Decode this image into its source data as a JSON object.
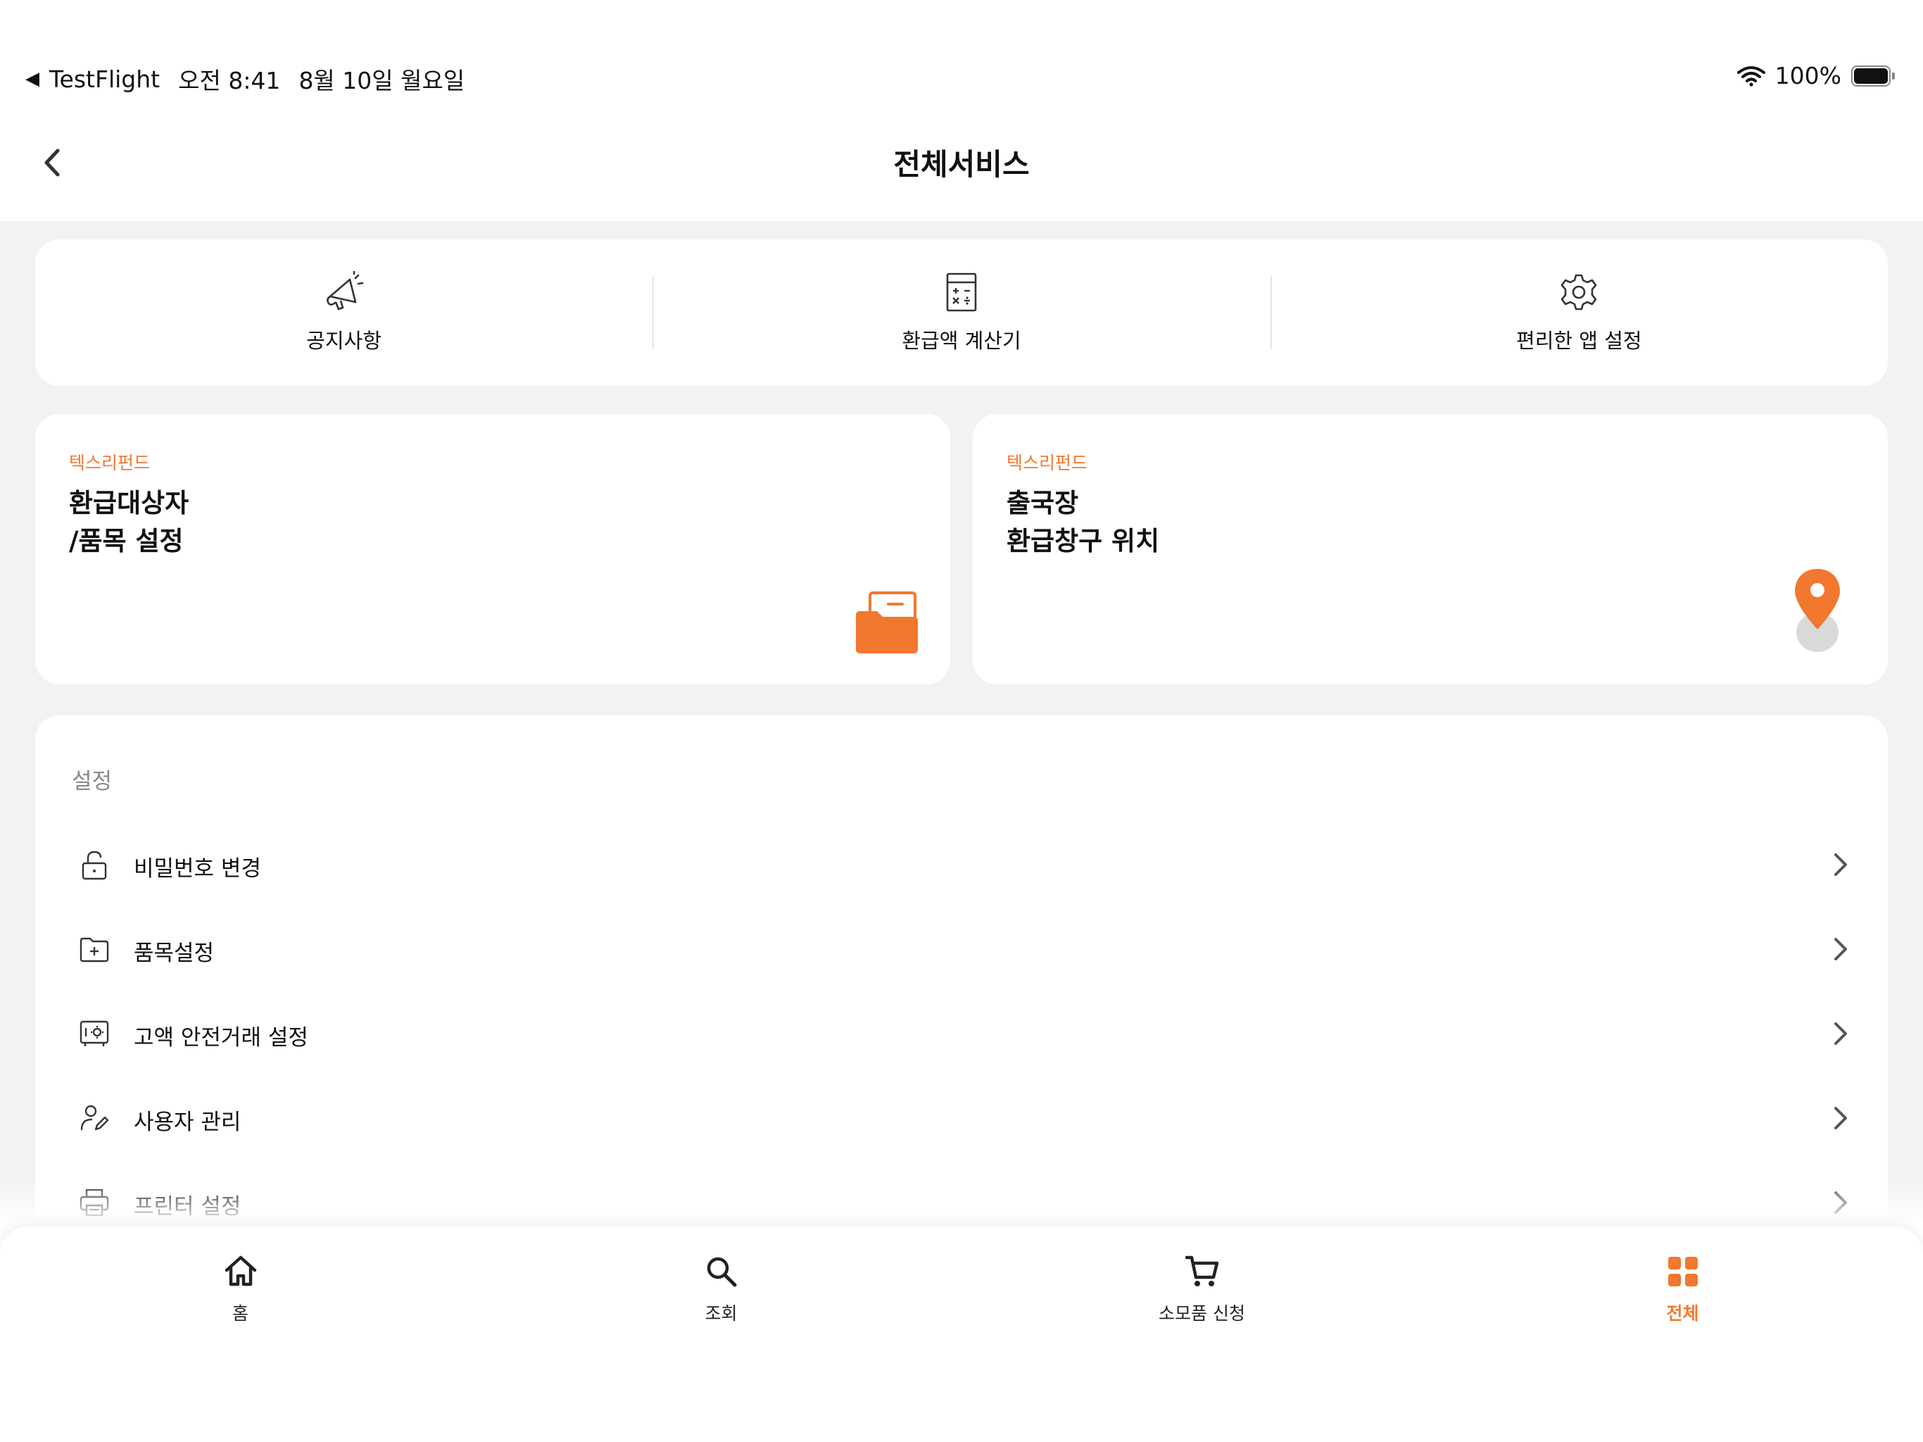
{
  "status_bar": {
    "back_app": "TestFlight",
    "time": "오전 8:41",
    "date": "8월 10일 월요일",
    "battery": "100%"
  },
  "nav": {
    "title": "전체서비스"
  },
  "quick_actions": [
    {
      "label": "공지사항",
      "icon": "megaphone-icon"
    },
    {
      "label": "환급액 계산기",
      "icon": "calculator-icon"
    },
    {
      "label": "편리한 앱 설정",
      "icon": "gear-icon"
    }
  ],
  "promo_cards": [
    {
      "brand": "텍스리펀드",
      "title_line1": "환급대상자",
      "title_line2": "/품목 설정",
      "icon": "folder-icon"
    },
    {
      "brand": "텍스리펀드",
      "title_line1": "출국장",
      "title_line2": "환급창구 위치",
      "icon": "location-pin-icon"
    }
  ],
  "settings": {
    "title": "설정",
    "items": [
      {
        "label": "비밀번호 변경",
        "icon": "unlock-icon"
      },
      {
        "label": "품목설정",
        "icon": "folder-plus-icon"
      },
      {
        "label": "고액 안전거래 설정",
        "icon": "safe-icon"
      },
      {
        "label": "사용자 관리",
        "icon": "user-edit-icon"
      },
      {
        "label": "프린터 설정",
        "icon": "printer-icon"
      }
    ]
  },
  "tab_bar": {
    "active": "전체",
    "accent": "#f2772f",
    "tabs": [
      {
        "label": "홈",
        "icon": "home-icon"
      },
      {
        "label": "조회",
        "icon": "search-icon"
      },
      {
        "label": "소모품 신청",
        "icon": "cart-icon"
      },
      {
        "label": "전체",
        "icon": "grid-icon"
      }
    ]
  }
}
